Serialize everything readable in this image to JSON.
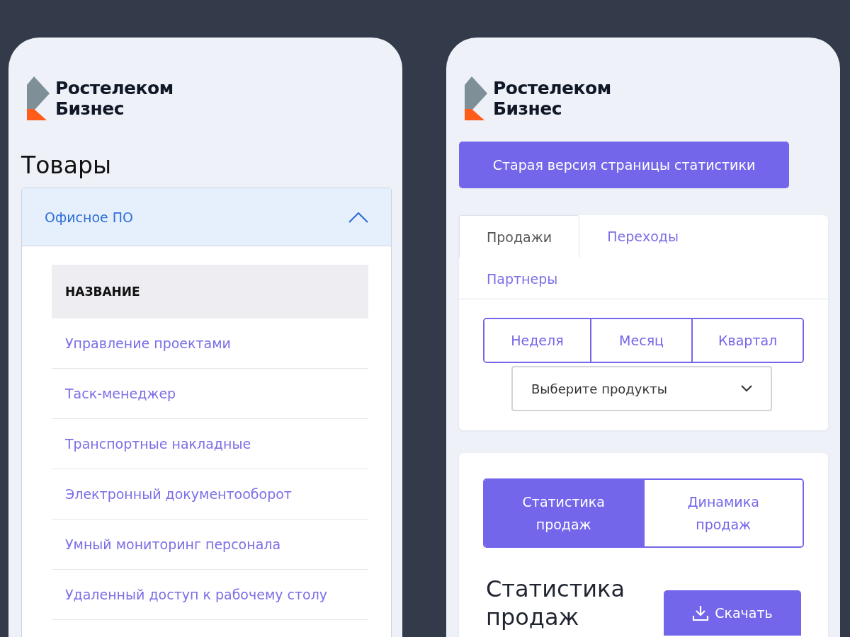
{
  "left_screen": {
    "logo": {
      "lines": [
        "Ростелеком",
        "Бизнес"
      ]
    },
    "title": "Товары",
    "accordion": {
      "label": "Офисное ПО",
      "expanded": true,
      "column_header": "НАЗВАНИЕ",
      "items": [
        "Управление проектами",
        "Таск-менеджер",
        "Транспортные накладные",
        "Электронный документооборот",
        "Умный мониторинг персонала",
        "Удаленный доступ к рабочему столу"
      ]
    }
  },
  "right_screen": {
    "logo": {
      "lines": [
        "Ростелеком",
        "Бизнес"
      ]
    },
    "old_version_button": "Старая версия страницы статистики",
    "tabs": [
      {
        "label": "Продажи",
        "selected": true
      },
      {
        "label": "Переходы",
        "selected": false
      },
      {
        "label": "Партнеры",
        "selected": false
      }
    ],
    "periods": [
      {
        "label": "Неделя",
        "selected": false
      },
      {
        "label": "Месяц",
        "selected": false
      },
      {
        "label": "Квартал",
        "selected": false
      }
    ],
    "product_select": {
      "placeholder": "Выберите продукты"
    },
    "view_toggle": [
      {
        "label": "Статистика продаж",
        "selected": true
      },
      {
        "label": "Динамика продаж",
        "selected": false
      }
    ],
    "section_title": "Статистика продаж",
    "download_button": "Скачать"
  }
}
